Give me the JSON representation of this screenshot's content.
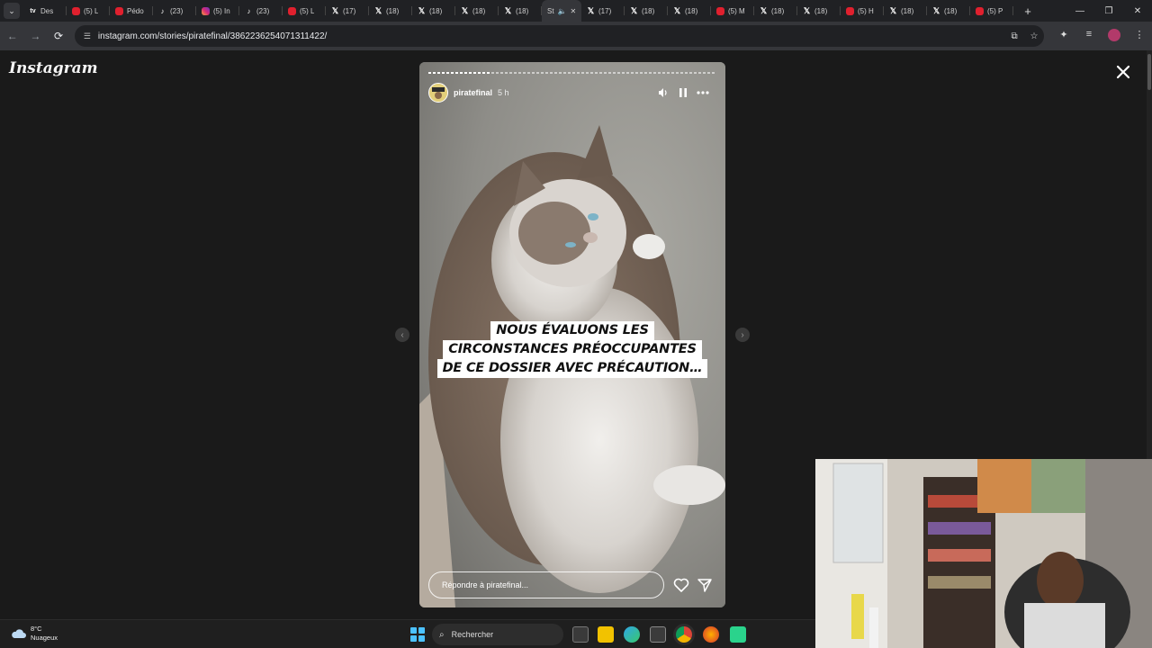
{
  "browser": {
    "tabs": [
      {
        "icon": "tv-favicon",
        "label": "Des"
      },
      {
        "icon": "youtube-favicon",
        "label": "(5) L"
      },
      {
        "icon": "youtube-favicon",
        "label": "Pédo"
      },
      {
        "icon": "tiktok-favicon",
        "label": "(23)"
      },
      {
        "icon": "instagram-favicon",
        "label": "(5) In"
      },
      {
        "icon": "tiktok-favicon",
        "label": "(23)"
      },
      {
        "icon": "youtube-favicon",
        "label": "(5) L"
      },
      {
        "icon": "x-favicon",
        "label": "(17)"
      },
      {
        "icon": "x-favicon",
        "label": "(18)"
      },
      {
        "icon": "x-favicon",
        "label": "(18)"
      },
      {
        "icon": "x-favicon",
        "label": "(18)"
      },
      {
        "icon": "x-favicon",
        "label": "(18)"
      },
      {
        "icon": "active",
        "label": "St"
      },
      {
        "icon": "x-favicon",
        "label": "(17)"
      },
      {
        "icon": "x-favicon",
        "label": "(18)"
      },
      {
        "icon": "x-favicon",
        "label": "(18)"
      },
      {
        "icon": "youtube-favicon",
        "label": "(5) M"
      },
      {
        "icon": "x-favicon",
        "label": "(18)"
      },
      {
        "icon": "x-favicon",
        "label": "(18)"
      },
      {
        "icon": "youtube-favicon",
        "label": "(5) H"
      },
      {
        "icon": "x-favicon",
        "label": "(18)"
      },
      {
        "icon": "x-favicon",
        "label": "(18)"
      },
      {
        "icon": "youtube-favicon",
        "label": "(5) P"
      }
    ],
    "url": "instagram.com/stories/piratefinal/3862236254071311422/"
  },
  "page": {
    "logo": "Instagram",
    "story": {
      "username": "piratefinal",
      "time": "5 h",
      "progress": 0.22,
      "caption_lines": [
        "NOUS ÉVALUONS LES",
        "CIRCONSTANCES PRÉOCCUPANTES",
        "DE CE DOSSIER AVEC PRÉCAUTION…"
      ],
      "reply_placeholder": "Répondre à piratefinal..."
    }
  },
  "taskbar": {
    "temperature": "8°C",
    "condition": "Nuageux",
    "search_label": "Rechercher"
  },
  "colors": {
    "page_bg": "#1a1a1a",
    "story_bg": "#8a8a86",
    "start_blue": "#4cc2ff"
  }
}
